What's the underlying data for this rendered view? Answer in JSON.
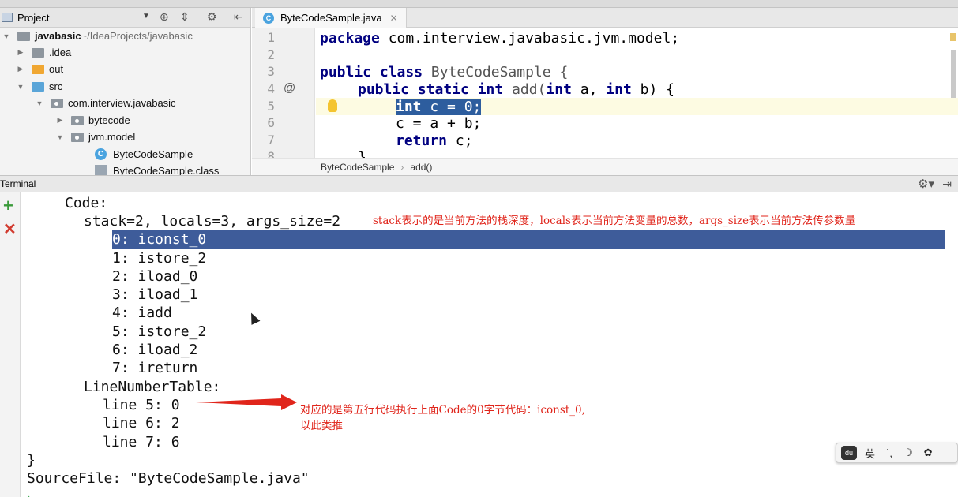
{
  "project_panel": {
    "title": "Project",
    "tree": [
      {
        "label": "javabasic",
        "suffix": " ~/IdeaProjects/javabasic",
        "kind": "module"
      },
      {
        "label": ".idea",
        "kind": "folder"
      },
      {
        "label": "out",
        "kind": "folder-orange"
      },
      {
        "label": "src",
        "kind": "folder-blue"
      },
      {
        "label": "com.interview.javabasic",
        "kind": "package"
      },
      {
        "label": "bytecode",
        "kind": "package"
      },
      {
        "label": "jvm.model",
        "kind": "package"
      },
      {
        "label": "ByteCodeSample",
        "kind": "class"
      },
      {
        "label": "ByteCodeSample.class",
        "kind": "classfile"
      }
    ]
  },
  "editor": {
    "tab_label": "ByteCodeSample.java",
    "tab_icon_letter": "C",
    "line_numbers": [
      "1",
      "2",
      "3",
      "4",
      "5",
      "6",
      "7",
      "8"
    ],
    "gutter_marker": "@",
    "lines": {
      "l1_kw": "package",
      "l1_rest": " com.interview.javabasic.jvm.model;",
      "l3_kw": "public class",
      "l3_rest": " ByteCodeSample {",
      "l4_kw1": "public static int",
      "l4_name": " add(",
      "l4_kw2": "int",
      "l4_mid": " a, ",
      "l4_kw3": "int",
      "l4_end": " b) {",
      "l5_kw": "int",
      "l5_rest": " c = 0;",
      "l6": "c = a + b;",
      "l7_kw": "return",
      "l7_rest": " c;",
      "l8": "}"
    },
    "breadcrumb": [
      "ByteCodeSample",
      "add()"
    ]
  },
  "terminal": {
    "title": "Terminal",
    "lines": [
      "Code:",
      "stack=2, locals=3, args_size=2",
      "0: iconst_0",
      "1: istore_2",
      "2: iload_0",
      "3: iload_1",
      "4: iadd",
      "5: istore_2",
      "6: iload_2",
      "7: ireturn",
      "LineNumberTable:",
      "line 5: 0",
      "line 6: 2",
      "line 7: 6",
      "}",
      "SourceFile: \"ByteCodeSample.java\""
    ],
    "annotation_stack": "stack表示的是当前方法的栈深度，locals表示当前方法变量的总数，args_size表示当前方法传参数量",
    "annotation_line_1": "对应的是第五行代码执行上面Code的0字节代码：iconst_0,",
    "annotation_line_2": "以此类推"
  },
  "ime": {
    "logo": "du",
    "lang": "英",
    "punct": "˙,",
    "moon": "☽",
    "settings": "✿"
  },
  "colors": {
    "selection": "#3e5c9a",
    "annotation": "#e0251b",
    "keyword": "#000080"
  }
}
